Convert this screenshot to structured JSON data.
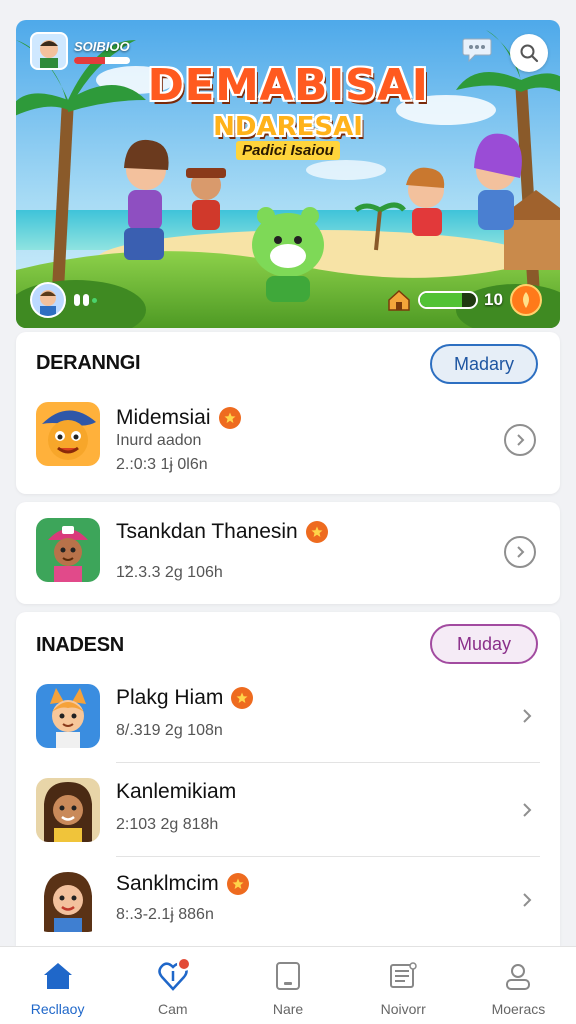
{
  "hero": {
    "player_name": "SOIBIOO",
    "player_health": 0.55,
    "title_line1": "DEMABISAI",
    "title_line2": "NDARESAI",
    "subtitle": "Padici Isaiou",
    "energy_level": 0.75,
    "energy_value": "10"
  },
  "section1": {
    "title": "DERANNGI",
    "button": "Madary",
    "items": [
      {
        "title": "Midemsiai",
        "subtitle": "Inurd aadon",
        "meta": "2.:0:3 1ɉ 0l6n"
      },
      {
        "title": "Tsankdan Thanesin",
        "meta": "1̃2.3.3 2ɡ 106h"
      }
    ]
  },
  "section2": {
    "title": "INADESN",
    "button": "Muday",
    "items": [
      {
        "title": "Plakg Hiam",
        "meta": "8/.319 2ɡ 108n"
      },
      {
        "title": "Kanlemikiam",
        "meta": "2:103 2ɡ 818h"
      },
      {
        "title": "Sanklmcim",
        "meta": "8:.3-2.1ɉ 886n"
      }
    ]
  },
  "tabs": [
    {
      "label": "Recllaoy",
      "icon": "home-icon"
    },
    {
      "label": "Cam",
      "icon": "heart-shield-icon"
    },
    {
      "label": "Nare",
      "icon": "tablet-icon"
    },
    {
      "label": "Noivorr",
      "icon": "news-icon"
    },
    {
      "label": "Moeracs",
      "icon": "profile-icon"
    }
  ],
  "colors": {
    "accent": "#1f67c9",
    "secondary": "#a24ba0",
    "badge": "#ee6b1f"
  }
}
